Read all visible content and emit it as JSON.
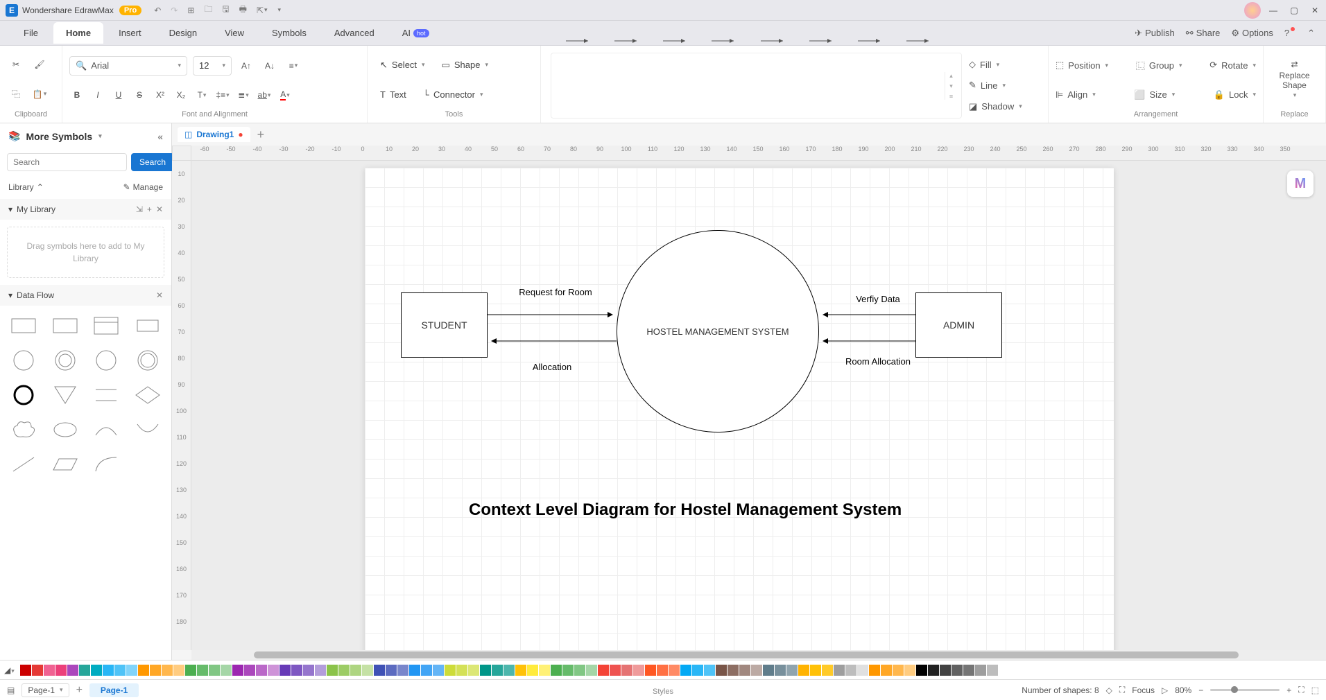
{
  "app": {
    "name": "Wondershare EdrawMax",
    "badge": "Pro"
  },
  "menu": {
    "tabs": [
      "File",
      "Home",
      "Insert",
      "Design",
      "View",
      "Symbols",
      "Advanced",
      "AI"
    ],
    "active": 1,
    "hot": "hot",
    "publish": "Publish",
    "share": "Share",
    "options": "Options"
  },
  "ribbon": {
    "clipboard_label": "Clipboard",
    "font_label": "Font and Alignment",
    "tools_label": "Tools",
    "styles_label": "Styles",
    "arrangement_label": "Arrangement",
    "replace_label": "Replace",
    "font_name": "Arial",
    "font_size": "12",
    "select": "Select",
    "shape": "Shape",
    "text": "Text",
    "connector": "Connector",
    "fill": "Fill",
    "line": "Line",
    "shadow": "Shadow",
    "position": "Position",
    "group": "Group",
    "rotate": "Rotate",
    "align": "Align",
    "size": "Size",
    "lock": "Lock",
    "replace_shape": "Replace\nShape"
  },
  "sidebar": {
    "title": "More Symbols",
    "search_placeholder": "Search",
    "search_btn": "Search",
    "library": "Library",
    "manage": "Manage",
    "mylib": "My Library",
    "droptext": "Drag symbols here to add to My Library",
    "dataflow": "Data Flow"
  },
  "doc": {
    "tab": "Drawing1"
  },
  "hruler": [
    "-60",
    "-50",
    "-40",
    "-30",
    "-20",
    "-10",
    "0",
    "10",
    "20",
    "30",
    "40",
    "50",
    "60",
    "70",
    "80",
    "90",
    "100",
    "110",
    "120",
    "130",
    "140",
    "150",
    "160",
    "170",
    "180",
    "190",
    "200",
    "210",
    "220",
    "230",
    "240",
    "250",
    "260",
    "270",
    "280",
    "290",
    "300",
    "310",
    "320",
    "330",
    "340",
    "350"
  ],
  "vruler": [
    "10",
    "20",
    "30",
    "40",
    "50",
    "60",
    "70",
    "80",
    "90",
    "100",
    "110",
    "120",
    "130",
    "140",
    "150",
    "160",
    "170",
    "180"
  ],
  "diagram": {
    "student": "STUDENT",
    "system": "HOSTEL MANAGEMENT SYSTEM",
    "admin": "ADMIN",
    "req": "Request for Room",
    "alloc": "Allocation",
    "verify": "Verfiy Data",
    "roomalloc": "Room Allocation",
    "title": "Context Level Diagram for Hostel Management System"
  },
  "colors": [
    "#c00",
    "#e53935",
    "#f06292",
    "#ec407a",
    "#ab47bc",
    "#26a69a",
    "#00acc1",
    "#29b6f6",
    "#4fc3f7",
    "#81d4fa",
    "#ff9800",
    "#ffa726",
    "#ffb74d",
    "#ffcc80",
    "#4caf50",
    "#66bb6a",
    "#81c784",
    "#a5d6a7",
    "#9c27b0",
    "#ab47bc",
    "#ba68c8",
    "#ce93d8",
    "#673ab7",
    "#7e57c2",
    "#9575cd",
    "#b39ddb",
    "#8bc34a",
    "#9ccc65",
    "#aed581",
    "#c5e1a5",
    "#3f51b5",
    "#5c6bc0",
    "#7986cb",
    "#2196f3",
    "#42a5f5",
    "#64b5f6",
    "#cddc39",
    "#d4e157",
    "#dce775",
    "#009688",
    "#26a69a",
    "#4db6ac",
    "#ffc107",
    "#ffeb3b",
    "#fff176",
    "#4caf50",
    "#66bb6a",
    "#81c784",
    "#a5d6a7",
    "#f44336",
    "#ef5350",
    "#e57373",
    "#ef9a9a",
    "#ff5722",
    "#ff7043",
    "#ff8a65",
    "#03a9f4",
    "#29b6f6",
    "#4fc3f7",
    "#795548",
    "#8d6e63",
    "#a1887f",
    "#bcaaa4",
    "#607d8b",
    "#78909c",
    "#90a4ae",
    "#ffb300",
    "#ffc107",
    "#ffca28",
    "#9e9e9e",
    "#bdbdbd",
    "#e0e0e0",
    "#ff9800",
    "#ffa726",
    "#ffb74d",
    "#ffcc80",
    "#000",
    "#212121",
    "#424242",
    "#616161",
    "#757575",
    "#9e9e9e",
    "#bdbdbd",
    "#fff"
  ],
  "status": {
    "page_select": "Page-1",
    "page_tab": "Page-1",
    "shapes": "Number of shapes: 8",
    "focus": "Focus",
    "zoom": "80%"
  }
}
